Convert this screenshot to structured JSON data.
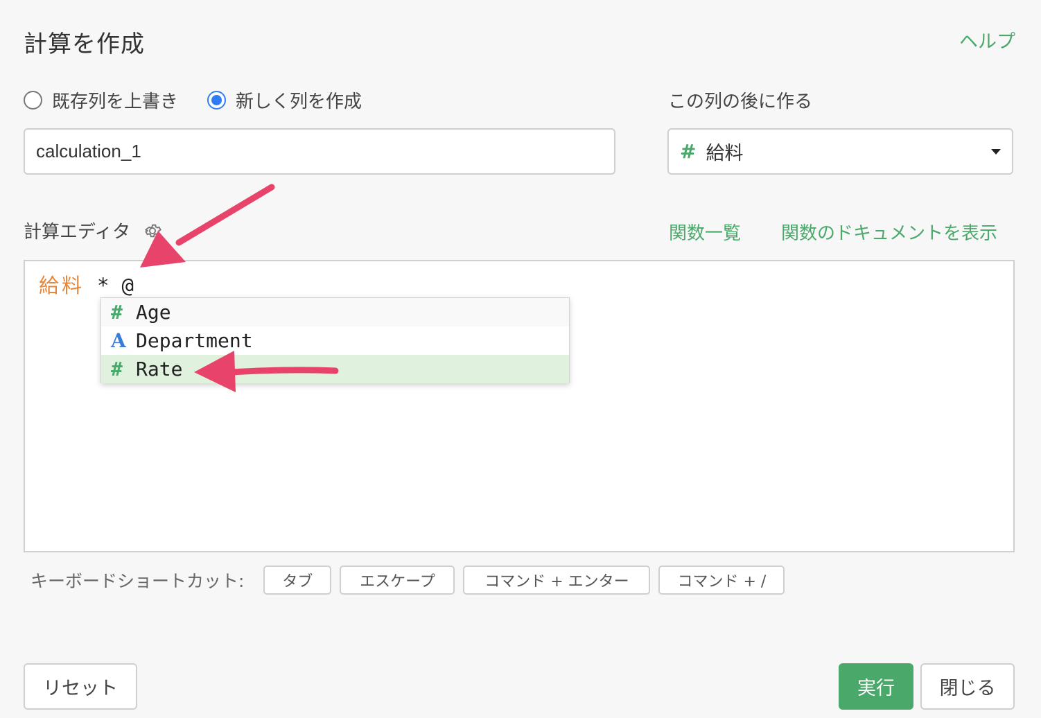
{
  "dialog": {
    "title": "計算を作成",
    "help_link": "ヘルプ"
  },
  "mode": {
    "options": [
      {
        "label": "既存列を上書き",
        "checked": false
      },
      {
        "label": "新しく列を作成",
        "checked": true
      }
    ]
  },
  "column_name": {
    "value": "calculation_1"
  },
  "position": {
    "label": "この列の後に作る",
    "selected_type": "#",
    "selected_value": "給料"
  },
  "editor": {
    "label": "計算エディタ",
    "function_list_link": "関数一覧",
    "function_doc_link": "関数のドキュメントを表示",
    "code": {
      "column": "給料",
      "operator": "*",
      "cursor_text": "@"
    }
  },
  "autocomplete": {
    "items": [
      {
        "type": "#",
        "type_icon": "number-type-icon",
        "name": "Age",
        "selected": false
      },
      {
        "type": "A",
        "type_icon": "text-type-icon",
        "name": "Department",
        "selected": false
      },
      {
        "type": "#",
        "type_icon": "number-type-icon",
        "name": "Rate",
        "selected": true
      }
    ]
  },
  "shortcuts": {
    "label": "キーボードショートカット:",
    "keys": [
      "タブ",
      "エスケープ",
      "コマンド + エンター",
      "コマンド + /"
    ]
  },
  "buttons": {
    "reset": "リセット",
    "run": "実行",
    "close": "閉じる"
  },
  "colors": {
    "accent_green": "#4aa86a",
    "radio_blue": "#2f7df5",
    "column_orange": "#e6863b",
    "arrow_pink": "#e8436b",
    "selected_row": "#e0f1de"
  }
}
